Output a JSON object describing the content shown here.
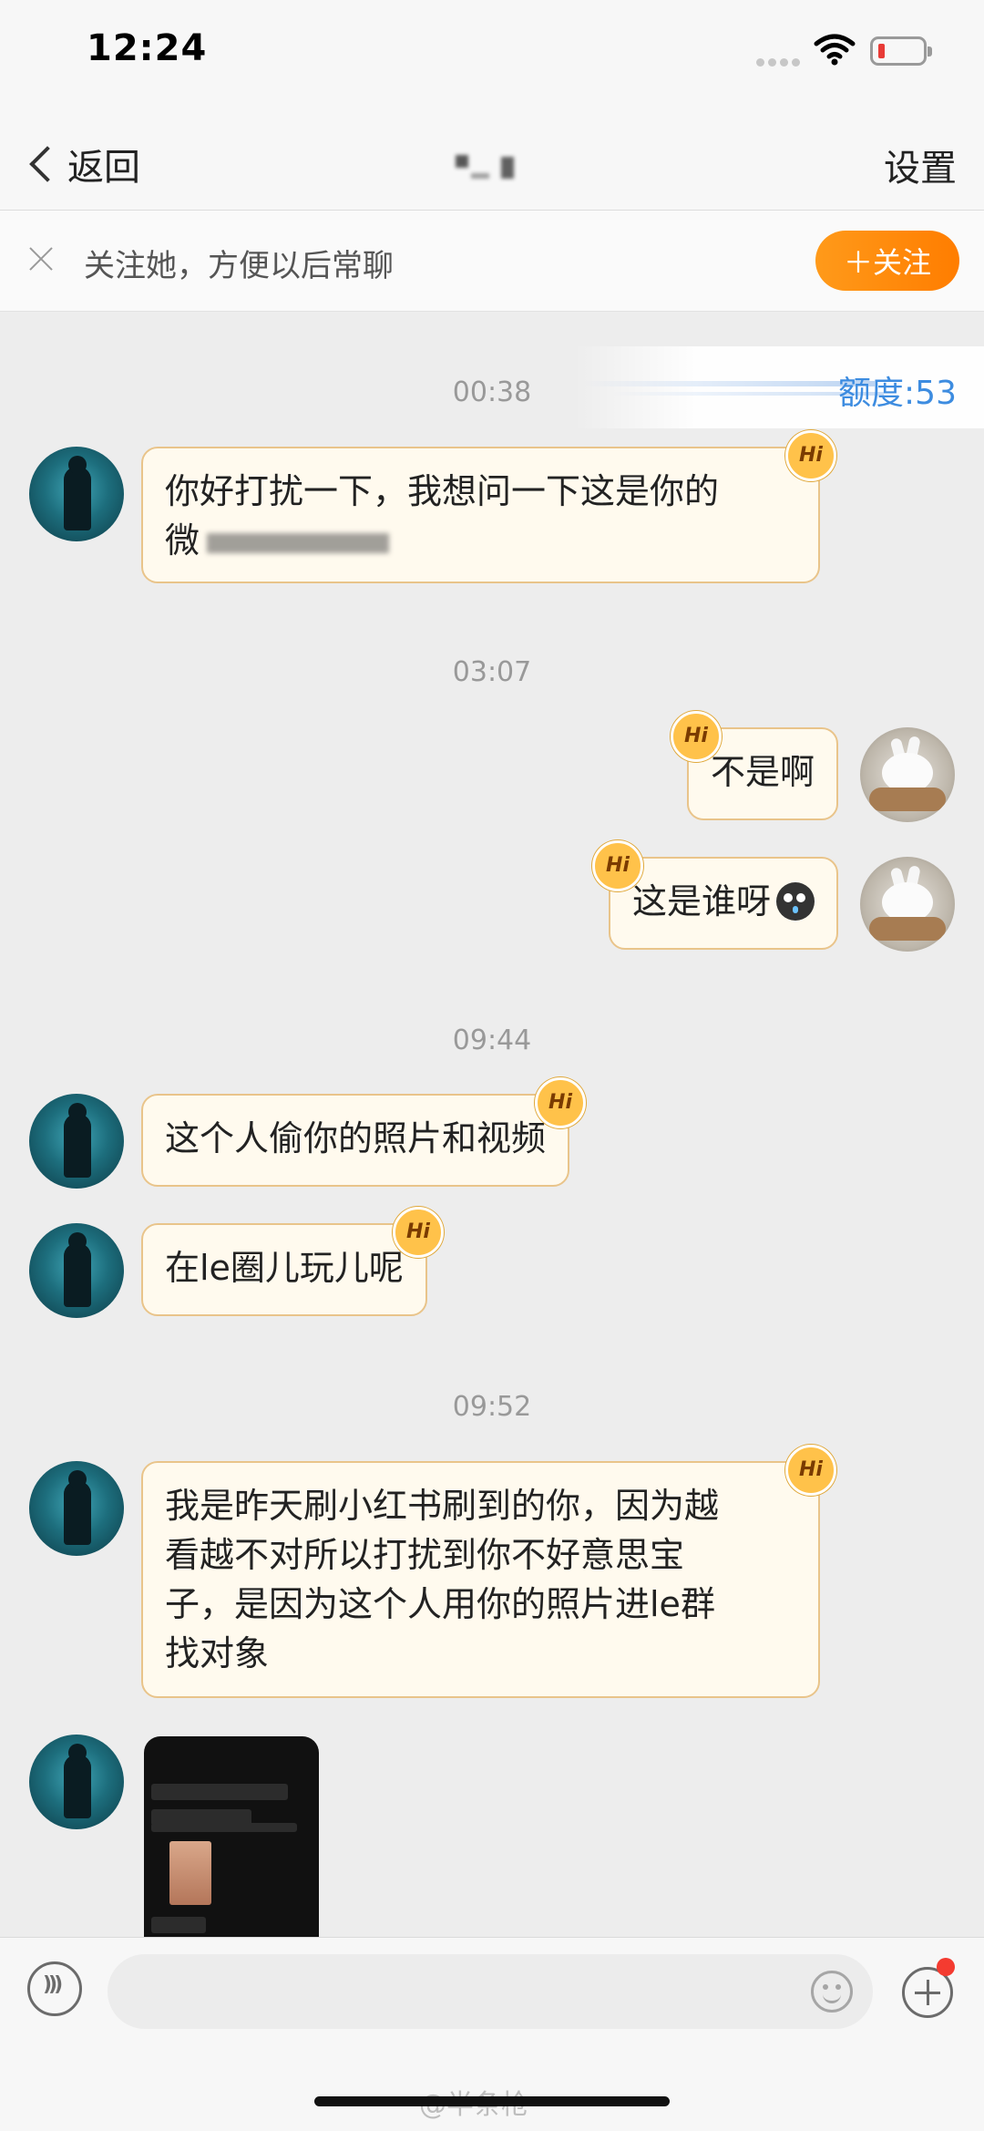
{
  "status_bar": {
    "time": "12:24"
  },
  "nav": {
    "back_label": "返回",
    "settings_label": "设置"
  },
  "follow_banner": {
    "text": "关注她，方便以后常聊",
    "button_label": "＋关注"
  },
  "quota": {
    "text": "额度:53"
  },
  "badge_text": "Hi",
  "messages": [
    {
      "time": "00:38"
    },
    {
      "from": "other",
      "text_line1": "你好打扰一下，我想问一下这是你的",
      "text_line2_visible": "微"
    },
    {
      "time": "03:07"
    },
    {
      "from": "me",
      "text": "不是啊"
    },
    {
      "from": "me",
      "text": "这是谁呀"
    },
    {
      "time": "09:44"
    },
    {
      "from": "other",
      "text": "这个人偷你的照片和视频"
    },
    {
      "from": "other",
      "text": "在le圈儿玩儿呢"
    },
    {
      "time": "09:52"
    },
    {
      "from": "other",
      "lines": [
        "我是昨天刷小红书刷到的你，因为越",
        "看越不对所以打扰到你不好意思宝",
        "子，是因为这个人用你的照片进le群",
        "找对象"
      ]
    },
    {
      "from": "other",
      "type": "image"
    }
  ],
  "input": {
    "placeholder": ""
  },
  "watermark": "@半条枪"
}
